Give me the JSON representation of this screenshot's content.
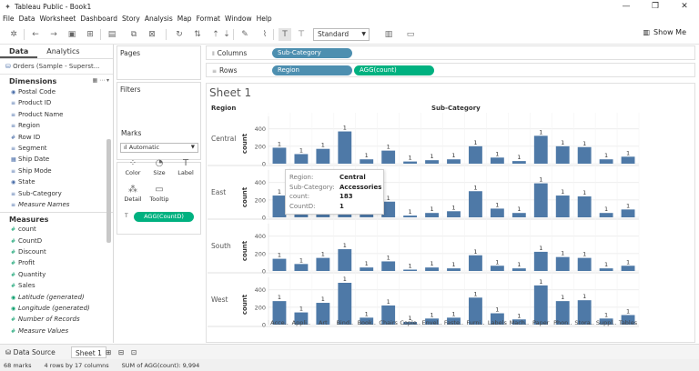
{
  "window": {
    "title": "Tableau Public - Book1",
    "controls": [
      "—",
      "❐",
      "✕"
    ]
  },
  "menu": [
    "File",
    "Data",
    "Worksheet",
    "Dashboard",
    "Story",
    "Analysis",
    "Map",
    "Format",
    "Window",
    "Help"
  ],
  "toolbar": {
    "fit_dropdown": "Standard",
    "show_me": "Show Me"
  },
  "left_panel": {
    "tabs": [
      "Data",
      "Analytics"
    ],
    "datasource": "Orders (Sample - Superst...",
    "dimensions_header": "Dimensions",
    "dimensions": [
      "Postal Code",
      "Product ID",
      "Product Name",
      "Region",
      "Row ID",
      "Segment",
      "Ship Date",
      "Ship Mode",
      "State",
      "Sub-Category",
      "Measure Names"
    ],
    "measures_header": "Measures",
    "measures": [
      "count",
      "CountD",
      "Discount",
      "Profit",
      "Quantity",
      "Sales",
      "Latitude (generated)",
      "Longitude (generated)",
      "Number of Records",
      "Measure Values"
    ]
  },
  "cards": {
    "pages": "Pages",
    "filters": "Filters",
    "marks": "Marks",
    "marks_type": "Automatic",
    "buttons": [
      "Color",
      "Size",
      "Label",
      "Detail",
      "Tooltip"
    ],
    "marks_pill": "AGG(CountD)"
  },
  "shelves": {
    "columns_label": "Columns",
    "rows_label": "Rows",
    "columns_pills": [
      "Sub-Category"
    ],
    "rows_pills": [
      "Region",
      "AGG(count)"
    ]
  },
  "sheet": {
    "title": "Sheet 1",
    "region_header": "Region",
    "subcat_header": "Sub-Category"
  },
  "tooltip": {
    "rows": [
      {
        "k": "Region:",
        "v": "Central"
      },
      {
        "k": "Sub-Category:",
        "v": "Accessories"
      },
      {
        "k": "count:",
        "v": "183"
      },
      {
        "k": "CountD:",
        "v": "1"
      }
    ]
  },
  "bottom": {
    "data_source_tab": "Data Source",
    "sheet_tab": "Sheet 1"
  },
  "status": [
    "68 marks",
    "4 rows by 17 columns",
    "SUM of AGG(count): 9,994"
  ],
  "colors": {
    "bar": "#4e79a7",
    "pill_blue": "#4d8fb0",
    "pill_green": "#00b180"
  },
  "chart_data": {
    "type": "bar",
    "categories": [
      "Acce..",
      "Appli..",
      "Art",
      "Bind..",
      "Book..",
      "Chairs",
      "Cople..",
      "Envel..",
      "Faste..",
      "Furni..",
      "Labels",
      "Mach..",
      "Paper",
      "Phon..",
      "Stora..",
      "Suppl..",
      "Tables"
    ],
    "ylabel": "count",
    "yticks": [
      0,
      200,
      400
    ],
    "ylim": [
      0,
      480
    ],
    "bar_label": "1",
    "series": [
      {
        "name": "Central",
        "values": [
          183,
          110,
          170,
          370,
          50,
          150,
          25,
          40,
          50,
          200,
          70,
          30,
          320,
          200,
          190,
          50,
          80
        ]
      },
      {
        "name": "East",
        "values": [
          250,
          140,
          230,
          430,
          60,
          180,
          20,
          50,
          70,
          300,
          100,
          50,
          390,
          250,
          240,
          50,
          90
        ]
      },
      {
        "name": "South",
        "values": [
          140,
          80,
          150,
          250,
          40,
          110,
          10,
          40,
          30,
          180,
          60,
          30,
          220,
          160,
          150,
          30,
          60
        ]
      },
      {
        "name": "West",
        "values": [
          270,
          140,
          250,
          480,
          80,
          220,
          30,
          70,
          80,
          310,
          130,
          60,
          450,
          270,
          280,
          70,
          110
        ]
      }
    ]
  }
}
